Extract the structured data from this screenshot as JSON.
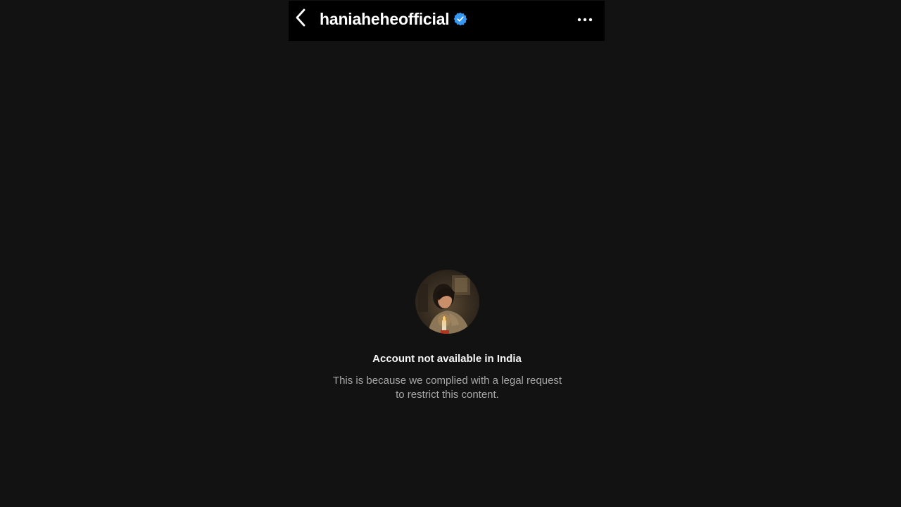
{
  "header": {
    "username": "haniaheheofficial",
    "verified_icon": "verified-badge-icon",
    "back_icon": "chevron-left-icon",
    "more_icon": "ellipsis-horizontal-icon",
    "accent_color": "#3897f0"
  },
  "restriction": {
    "title": "Account not available in India",
    "description_line1": "This is because we complied with a legal request",
    "description_line2": "to restrict this content."
  },
  "colors": {
    "background": "#121212",
    "header_background": "#000000",
    "title_text": "#f5f5f5",
    "secondary_text": "#a8a8a8"
  }
}
